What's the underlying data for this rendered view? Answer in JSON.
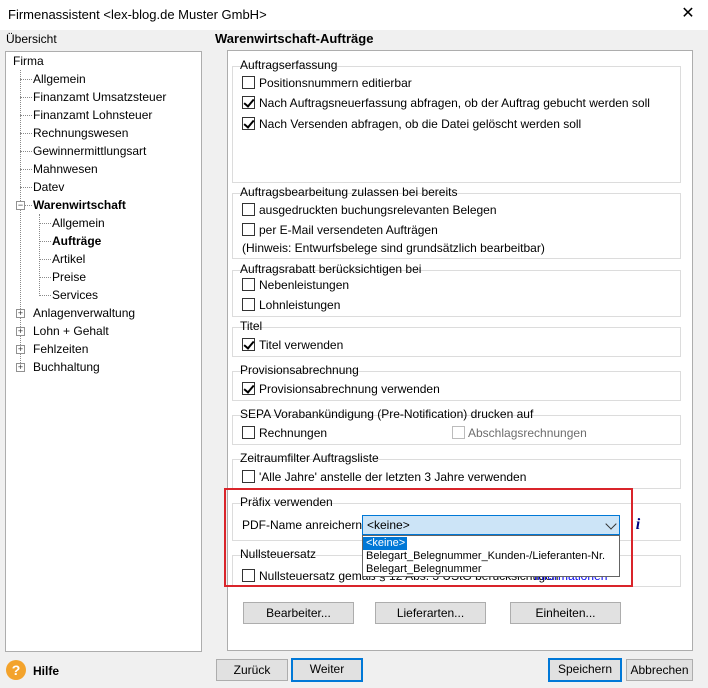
{
  "window": {
    "title": "Firmenassistent <lex-blog.de Muster GmbH>",
    "close_glyph": "✕"
  },
  "overview_label": "Übersicht",
  "section_title": "Warenwirtschaft-Aufträge",
  "tree": {
    "root": "Firma",
    "allgemein": "Allgemein",
    "finanzamt_ust": "Finanzamt Umsatzsteuer",
    "finanzamt_lst": "Finanzamt Lohnsteuer",
    "rechnungswesen": "Rechnungswesen",
    "gewinnermittlung": "Gewinnermittlungsart",
    "mahnwesen": "Mahnwesen",
    "datev": "Datev",
    "warenwirtschaft": "Warenwirtschaft",
    "ww_allgemein": "Allgemein",
    "ww_auftraege": "Aufträge",
    "ww_artikel": "Artikel",
    "ww_preise": "Preise",
    "ww_services": "Services",
    "anlagen": "Anlagenverwaltung",
    "lohn": "Lohn + Gehalt",
    "fehlzeiten": "Fehlzeiten",
    "buchhaltung": "Buchhaltung",
    "expander_glyph": "+"
  },
  "groups": {
    "auftragserfassung": {
      "title": "Auftragserfassung",
      "opt1": "Positionsnummern editierbar",
      "opt1_checked": false,
      "opt2": "Nach Auftragsneuerfassung abfragen, ob der Auftrag gebucht werden soll",
      "opt2_checked": true,
      "opt3": "Nach Versenden abfragen, ob die Datei gelöscht werden soll",
      "opt3_checked": true
    },
    "bearbeitung": {
      "title": "Auftragsbearbeitung zulassen bei bereits",
      "opt1": "ausgedruckten buchungsrelevanten Belegen",
      "opt1_checked": false,
      "opt2": "per E-Mail versendeten Aufträgen",
      "opt2_checked": false,
      "hint": "(Hinweis: Entwurfsbelege sind grundsätzlich bearbeitbar)"
    },
    "rabatt": {
      "title": "Auftragsrabatt berücksichtigen bei",
      "opt1": "Nebenleistungen",
      "opt1_checked": false,
      "opt2": "Lohnleistungen",
      "opt2_checked": false
    },
    "titel": {
      "title": "Titel",
      "opt1": "Titel verwenden",
      "opt1_checked": true
    },
    "provision": {
      "title": "Provisionsabrechnung",
      "opt1": "Provisionsabrechnung verwenden",
      "opt1_checked": true
    },
    "sepa": {
      "title": "SEPA Vorabankündigung (Pre-Notification) drucken auf",
      "opt1": "Rechnungen",
      "opt1_checked": false,
      "opt2": "Abschlagsrechnungen",
      "opt2_checked": false
    },
    "zeitraum": {
      "title": "Zeitraumfilter Auftragsliste",
      "opt1": "'Alle Jahre' anstelle der letzten 3 Jahre verwenden",
      "opt1_checked": false
    },
    "praefix": {
      "title": "Präfix verwenden",
      "field_label": "PDF-Name anreichern",
      "selected": "<keine>",
      "options": [
        "<keine>",
        "Belegart_Belegnummer_Kunden-/Lieferanten-Nr.",
        "Belegart_Belegnummer"
      ],
      "info_glyph": "i"
    },
    "nullsteuer": {
      "title": "Nullsteuersatz",
      "opt1": "Nullsteuersatz gemäß § 12 Abs. 3 UStG berücksichtigen",
      "opt1_checked": false,
      "link": "Informationen"
    }
  },
  "content_buttons": {
    "bearbeiter": "Bearbeiter...",
    "lieferarten": "Lieferarten...",
    "einheiten": "Einheiten..."
  },
  "footer": {
    "help": "Hilfe",
    "help_glyph": "?",
    "back": "Zurück",
    "next": "Weiter",
    "save": "Speichern",
    "cancel": "Abbrechen"
  },
  "colors": {
    "highlight": "#d9242a",
    "accent": "#0078d7",
    "link": "#0000ee"
  }
}
